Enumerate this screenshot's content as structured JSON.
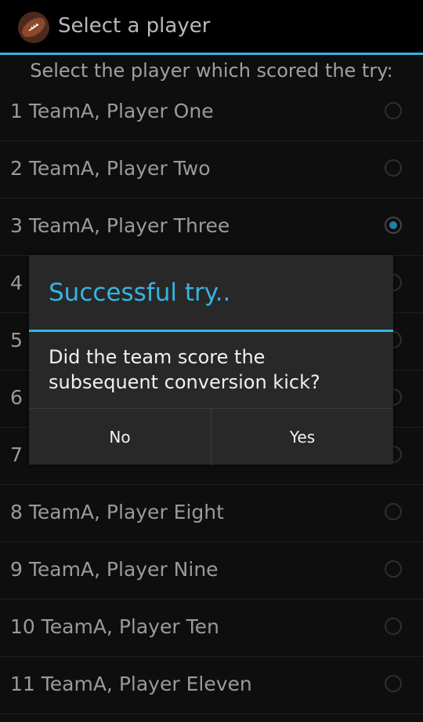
{
  "actionbar": {
    "title": "Select a player",
    "icon": "football-icon"
  },
  "prompt": "Select the player which scored the try:",
  "players": [
    {
      "label": "1 TeamA, Player One",
      "checked": false
    },
    {
      "label": "2 TeamA, Player Two",
      "checked": false
    },
    {
      "label": "3 TeamA, Player Three",
      "checked": true
    },
    {
      "label": "4",
      "checked": false
    },
    {
      "label": "5",
      "checked": false
    },
    {
      "label": "6",
      "checked": false
    },
    {
      "label": "7",
      "checked": false
    },
    {
      "label": "8 TeamA, Player Eight",
      "checked": false
    },
    {
      "label": "9 TeamA, Player Nine",
      "checked": false
    },
    {
      "label": "10 TeamA, Player Ten",
      "checked": false
    },
    {
      "label": "11 TeamA, Player Eleven",
      "checked": false
    }
  ],
  "dialog": {
    "title": "Successful try..",
    "message": "Did the team score the subsequent conversion kick?",
    "no_label": "No",
    "yes_label": "Yes"
  },
  "colors": {
    "accent": "#33b5e5",
    "radio_selected": "#1f7fa6"
  }
}
